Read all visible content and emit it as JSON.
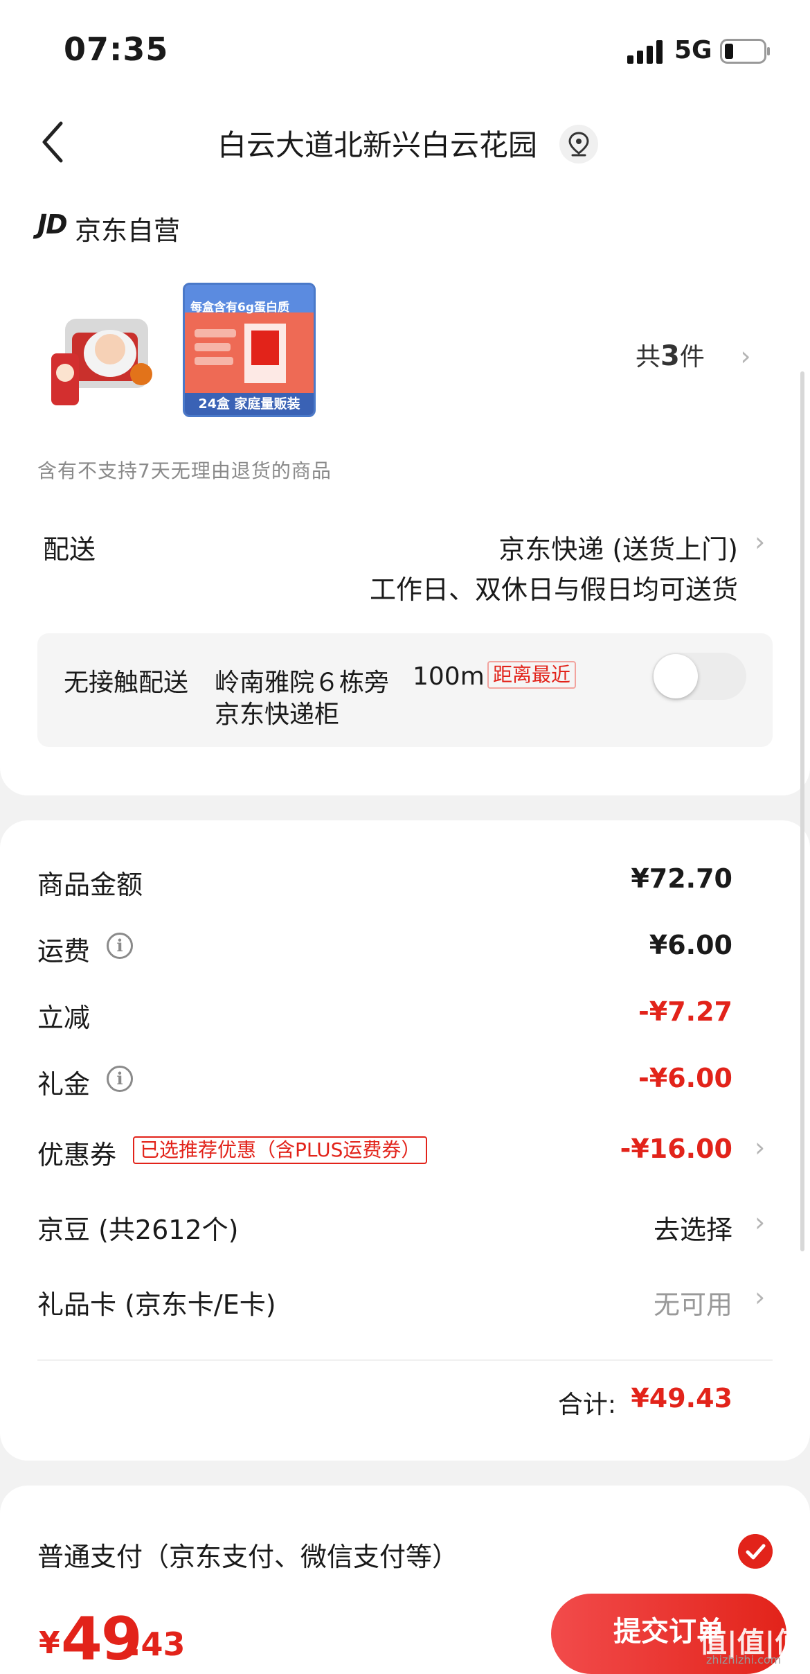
{
  "status": {
    "time": "07:35",
    "network": "5G"
  },
  "header": {
    "title": "白云大道北新兴白云花园"
  },
  "store": {
    "logo": "JD",
    "name": "京东自营"
  },
  "products": {
    "item2_top": "每盒含有6g蛋白质",
    "item2_bottom": "24盒 家庭量贩装",
    "count_prefix": "共",
    "count_num": "3",
    "count_suffix": "件"
  },
  "notice": "含有不支持7天无理由退货的商品",
  "shipping": {
    "label": "配送",
    "method": "京东快递 (送货上门)",
    "time": "工作日、双休日与假日均可送货"
  },
  "contactless": {
    "label": "无接触配送",
    "place": "岭南雅院６栋旁",
    "distance": "100m",
    "tag": "距离最近",
    "place2": "京东快递柜",
    "enabled": false
  },
  "summary": {
    "goods_label": "商品金额",
    "goods_value": "¥72.70",
    "freight_label": "运费",
    "freight_value": "¥6.00",
    "discount_label": "立减",
    "discount_value": "-¥7.27",
    "gift_label": "礼金",
    "gift_value": "-¥6.00",
    "coupon_label": "优惠券",
    "coupon_tag": "已选推荐优惠（含PLUS运费券）",
    "coupon_value": "-¥16.00",
    "beans_label": "京豆 (共2612个)",
    "beans_value": "去选择",
    "giftcard_label": "礼品卡 (京东卡/E卡)",
    "giftcard_value": "无可用",
    "total_label": "合计:",
    "total_value": "¥49.43"
  },
  "payment": {
    "method": "普通支付（京东支付、微信支付等）",
    "price_symbol": "¥",
    "price_int": "49",
    "price_dec": ".43",
    "submit_label": "提交订单"
  },
  "watermark": {
    "text": "值|值|值",
    "url": "zhizhizhi.com"
  },
  "colors": {
    "accent": "#e2231a",
    "bg": "#f2f2f2"
  }
}
